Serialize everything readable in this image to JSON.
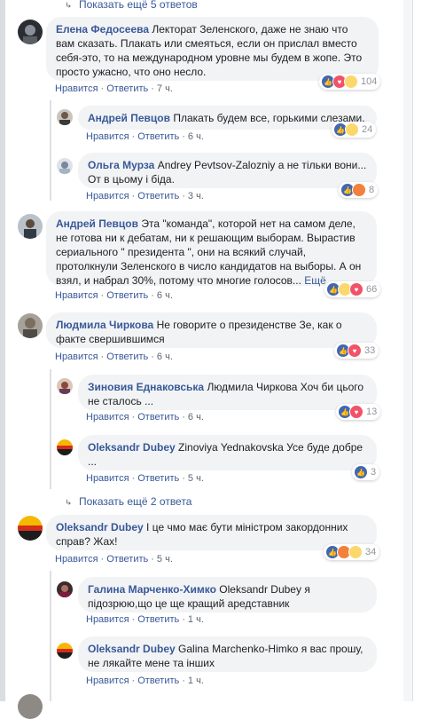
{
  "top_more": "Показать ещё 5 ответов",
  "actions": {
    "like": "Нравится",
    "reply": "Ответить"
  },
  "comments": [
    {
      "name": "Елена Федосеева",
      "text": "Лекторат Зеленского, даже не знаю что вам сказать. Плакать или смеяться, если он прислал вместо себя-это, то на международном уровне мы будем в жопе. Это просто ужасно, что оно несло.",
      "time": "7 ч.",
      "count": "104",
      "reactions": [
        "like-icon",
        "love-icon",
        "sad-icon"
      ]
    },
    {
      "name": "Андрей Певцов",
      "text": "Плакать будем все, горькими слезами.",
      "time": "6 ч.",
      "count": "24",
      "reactions": [
        "like-icon",
        "sad-icon"
      ]
    },
    {
      "name": "Ольга Мурза",
      "text": "Andrey Pevtsov-Zalozniy а не тільки вони... От в цьому і біда.",
      "time": "3 ч.",
      "count": "8",
      "reactions": [
        "like-icon",
        "angry-icon"
      ]
    },
    {
      "name": "Андрей Певцов",
      "text": "Эта \"команда\", которой нет на самом деле, не готова ни к дебатам, ни к решающим выборам. Вырастив сериального \" президента \", они на всякий случай, протолкнули Зеленского в число кандидатов на выборы. А он взял, и набрал 30%, потому что многие голосов...",
      "more": "Ещё",
      "time": "6 ч.",
      "count": "66",
      "reactions": [
        "like-icon",
        "sad-icon",
        "love-icon"
      ]
    },
    {
      "name": "Людмила Чиркова",
      "text": "Не говорите о президенстве Зе, как о факте свершившимся",
      "time": "6 ч.",
      "count": "33",
      "reactions": [
        "like-icon",
        "love-icon"
      ]
    },
    {
      "name": "Зиновия Еднаковська",
      "text": "Людмила Чиркова Хоч би цього не сталось ...",
      "time": "6 ч.",
      "count": "13",
      "reactions": [
        "like-icon",
        "love-icon"
      ]
    },
    {
      "name": "Oleksandr Dubey",
      "text": "Zinoviya Yednakovska Усе буде добре ...",
      "time": "5 ч.",
      "count": "3",
      "reactions": [
        "like-icon"
      ]
    },
    {
      "name": "Oleksandr Dubey",
      "text": "І це чмо має бути міністром закордонних справ? Жах!",
      "time": "5 ч.",
      "count": "34",
      "reactions": [
        "like-icon",
        "angry-icon",
        "wow-icon"
      ]
    },
    {
      "name": "Галина Марченко-Химко",
      "text": "Oleksandr Dubey я підозрюю,що це ще кращий аредставник",
      "time": "1 ч.",
      "count": "",
      "reactions": []
    },
    {
      "name": "Oleksandr Dubey",
      "text": "Galina Marchenko-Himko я вас прошу, не лякайте мене та інших",
      "time": "1 ч.",
      "count": "",
      "reactions": []
    }
  ],
  "mid_more": "Показать ещё 2 ответа",
  "colors": {
    "link": "#385898",
    "bubble": "#f2f3f5",
    "meta": "#606770",
    "like": "#4267b2",
    "love": "#f25268"
  }
}
